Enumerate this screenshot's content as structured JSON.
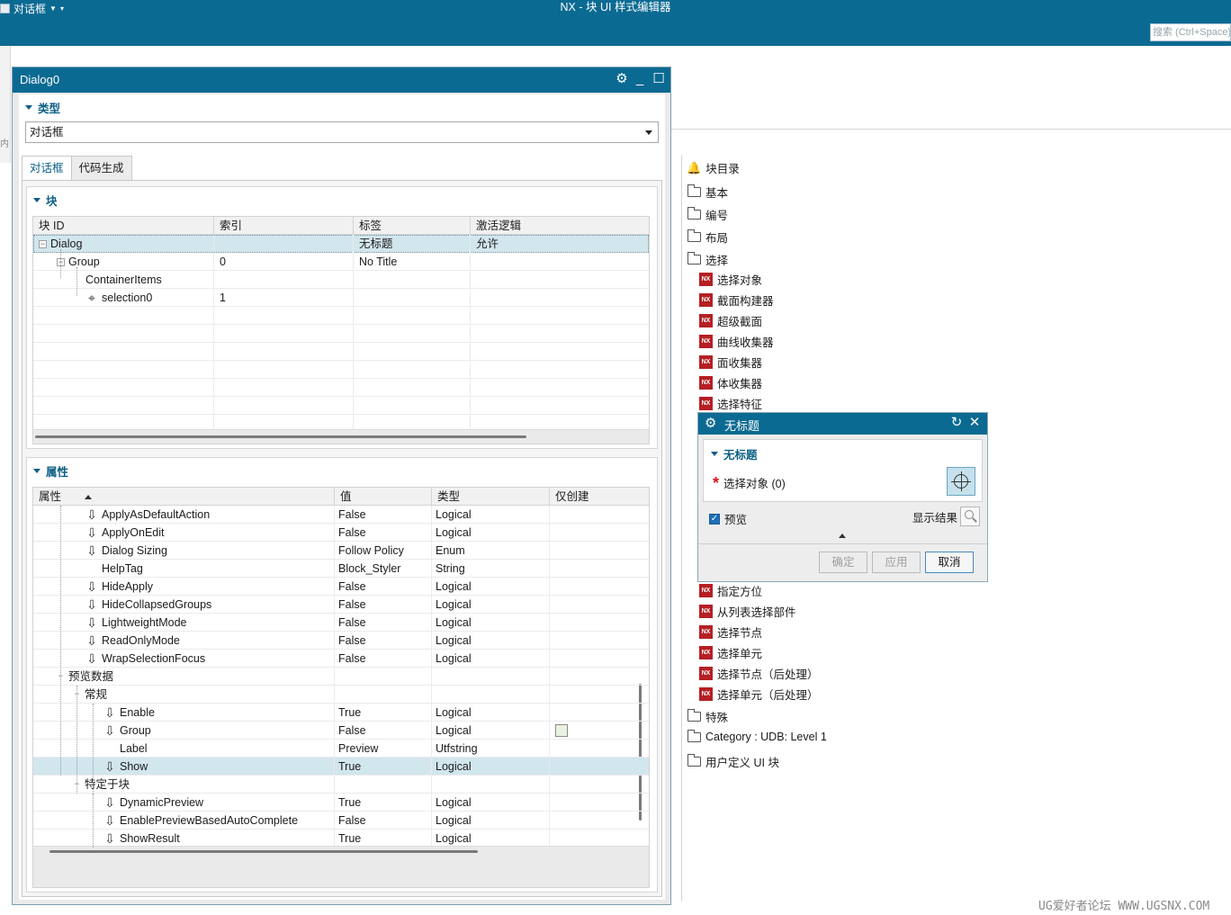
{
  "app": {
    "menu_label": "对话框",
    "window_title": "NX - 块 UI 样式编辑器",
    "search_placeholder": "搜索 (Ctrl+Space)"
  },
  "dialog0": {
    "title": "Dialog0",
    "type_section": {
      "title": "类型",
      "selected": "对话框"
    },
    "tabs": [
      {
        "label": "对话框",
        "active": true
      },
      {
        "label": "代码生成",
        "active": false
      }
    ],
    "blocks": {
      "title": "块",
      "columns": [
        "块 ID",
        "索引",
        "标签",
        "激活逻辑"
      ],
      "rows": [
        {
          "id": "Dialog",
          "index": "",
          "label": "无标题",
          "logic": "允许",
          "expander": "−",
          "selected": true
        },
        {
          "id": "Group",
          "index": "0",
          "label": "No Title",
          "logic": "",
          "expander": "−"
        },
        {
          "id": "ContainerItems",
          "index": "",
          "label": "",
          "logic": ""
        },
        {
          "id": "selection0",
          "index": "1",
          "label": "",
          "logic": "",
          "icon": "⌖"
        }
      ]
    },
    "properties": {
      "title": "属性",
      "columns": [
        "属性",
        "值",
        "类型",
        "仅创建"
      ],
      "rows": [
        {
          "name": "ApplyAsDefaultAction",
          "value": "False",
          "type": "Logical"
        },
        {
          "name": "ApplyOnEdit",
          "value": "False",
          "type": "Logical"
        },
        {
          "name": "Dialog Sizing",
          "value": "Follow Policy",
          "type": "Enum"
        },
        {
          "name": "HelpTag",
          "value": "Block_Styler",
          "type": "String"
        },
        {
          "name": "HideApply",
          "value": "False",
          "type": "Logical"
        },
        {
          "name": "HideCollapsedGroups",
          "value": "False",
          "type": "Logical"
        },
        {
          "name": "LightweightMode",
          "value": "False",
          "type": "Logical"
        },
        {
          "name": "ReadOnlyMode",
          "value": "False",
          "type": "Logical"
        },
        {
          "name": "WrapSelectionFocus",
          "value": "False",
          "type": "Logical"
        },
        {
          "name": "预览数据",
          "value": "",
          "type": "",
          "group": true
        },
        {
          "name": "常规",
          "value": "",
          "type": "",
          "group": true
        },
        {
          "name": "Enable",
          "value": "True",
          "type": "Logical"
        },
        {
          "name": "Group",
          "value": "False",
          "type": "Logical"
        },
        {
          "name": "Label",
          "value": "Preview",
          "type": "Utfstring"
        },
        {
          "name": "Show",
          "value": "True",
          "type": "Logical",
          "selected": true
        },
        {
          "name": "特定于块",
          "value": "",
          "type": "",
          "group": true
        },
        {
          "name": "DynamicPreview",
          "value": "True",
          "type": "Logical"
        },
        {
          "name": "EnablePreviewBasedAutoComplete",
          "value": "False",
          "type": "Logical"
        },
        {
          "name": "ShowResult",
          "value": "True",
          "type": "Logical"
        }
      ]
    }
  },
  "catalog": {
    "title": "块目录",
    "folders_top": [
      "基本",
      "编号",
      "布局",
      "选择"
    ],
    "selection_items_top": [
      "选择对象",
      "截面构建器",
      "超级截面",
      "曲线收集器",
      "面收集器",
      "体收集器",
      "选择特征"
    ],
    "selection_items_bottom": [
      "指定方位",
      "从列表选择部件",
      "选择节点",
      "选择单元",
      "选择节点（后处理）",
      "选择单元（后处理）"
    ],
    "folders_bottom": [
      "特殊",
      "Category : UDB: Level 1",
      "用户定义 UI 块"
    ]
  },
  "untitled_dialog": {
    "title": "无标题",
    "section_title": "无标题",
    "select_label": "选择对象 (0)",
    "preview_label": "预览",
    "show_result_label": "显示结果",
    "ok": "确定",
    "apply": "应用",
    "cancel": "取消"
  },
  "watermark": "UG爱好者论坛 WWW.UGSNX.COM"
}
